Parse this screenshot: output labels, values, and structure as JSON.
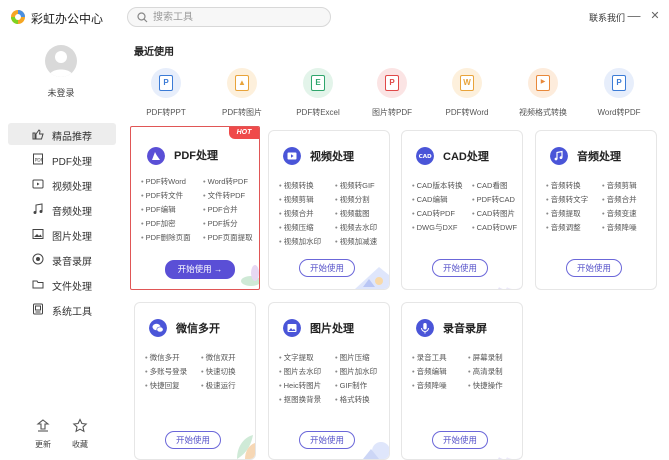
{
  "app": {
    "name": "彩虹办公中心"
  },
  "search": {
    "placeholder": "搜索工具"
  },
  "header": {
    "contact": "联系我们",
    "minimize_glyph": "—",
    "close_glyph": "✕"
  },
  "user": {
    "status": "未登录"
  },
  "sidebar": {
    "items": [
      {
        "label": "精品推荐",
        "icon": "thumbs-up-icon",
        "active": true
      },
      {
        "label": "PDF处理",
        "icon": "pdf-icon"
      },
      {
        "label": "视频处理",
        "icon": "video-icon"
      },
      {
        "label": "音频处理",
        "icon": "music-icon"
      },
      {
        "label": "图片处理",
        "icon": "image-icon"
      },
      {
        "label": "录音录屏",
        "icon": "record-icon"
      },
      {
        "label": "文件处理",
        "icon": "folder-icon"
      },
      {
        "label": "系统工具",
        "icon": "system-icon"
      }
    ],
    "bottom": [
      {
        "label": "更新",
        "icon": "update-icon"
      },
      {
        "label": "收藏",
        "icon": "star-icon"
      }
    ]
  },
  "recent": {
    "title": "最近使用",
    "items": [
      {
        "label": "PDF转PPT",
        "icon": "pdf-to-ppt-icon",
        "letter": "P",
        "color": "#3b7bd6",
        "bg": "#e7eefb"
      },
      {
        "label": "PDF转图片",
        "icon": "pdf-to-image-icon",
        "letter": "▲",
        "color": "#e8a33a",
        "bg": "#fdf0dc"
      },
      {
        "label": "PDF转Excel",
        "icon": "pdf-to-excel-icon",
        "letter": "E",
        "color": "#2ea56b",
        "bg": "#e3f4ea"
      },
      {
        "label": "图片转PDF",
        "icon": "image-to-pdf-icon",
        "letter": "P",
        "color": "#e04848",
        "bg": "#fbe4e4"
      },
      {
        "label": "PDF转Word",
        "icon": "pdf-to-word-icon",
        "letter": "W",
        "color": "#e8a33a",
        "bg": "#fdf0dc"
      },
      {
        "label": "视频格式转换",
        "icon": "video-convert-icon",
        "letter": "▶",
        "color": "#e8883a",
        "bg": "#fdecdc"
      },
      {
        "label": "Word转PDF",
        "icon": "word-to-pdf-icon",
        "letter": "P",
        "color": "#3b7bd6",
        "bg": "#e7eefb"
      }
    ]
  },
  "cards": [
    {
      "title": "PDF处理",
      "icon": "pdf-icon",
      "color": "#5a4fd6",
      "hot": "HOT",
      "start": "开始使用 →",
      "filled": true,
      "features": [
        "PDF转Word",
        "Word转PDF",
        "PDF转文件",
        "文件转PDF",
        "PDF编辑",
        "PDF合并",
        "PDF加密",
        "PDF拆分",
        "PDF删除页面",
        "PDF页面提取"
      ]
    },
    {
      "title": "视频处理",
      "icon": "video-icon",
      "color": "#4a55d8",
      "start": "开始使用",
      "features": [
        "视频转换",
        "视频转GIF",
        "视频剪辑",
        "视频分割",
        "视频合并",
        "视频截图",
        "视频压缩",
        "视频去水印",
        "视频加水印",
        "视频加减速"
      ]
    },
    {
      "title": "CAD处理",
      "icon": "cad-icon",
      "color": "#4a55d8",
      "start": "开始使用",
      "features": [
        "CAD版本转换",
        "CAD看图",
        "CAD编辑",
        "PDF转CAD",
        "CAD转PDF",
        "CAD转图片",
        "DWG与DXF",
        "CAD转DWF"
      ]
    },
    {
      "title": "音频处理",
      "icon": "music-icon",
      "color": "#4a55d8",
      "start": "开始使用",
      "features": [
        "音频转换",
        "音频剪辑",
        "音频转文字",
        "音频合并",
        "音频提取",
        "音频变速",
        "音频调整",
        "音频降噪"
      ]
    },
    {
      "title": "微信多开",
      "icon": "wechat-icon",
      "color": "#4a55d8",
      "start": "开始使用",
      "features": [
        "微信多开",
        "微信双开",
        "多账号登录",
        "快速切换",
        "快捷回复",
        "极速运行"
      ]
    },
    {
      "title": "图片处理",
      "icon": "image-icon",
      "color": "#4a55d8",
      "start": "开始使用",
      "features": [
        "文字提取",
        "图片压缩",
        "图片去水印",
        "图片加水印",
        "Heic转图片",
        "GIF制作",
        "抠图换背景",
        "格式转换"
      ]
    },
    {
      "title": "录音录屏",
      "icon": "mic-icon",
      "color": "#4a55d8",
      "start": "开始使用",
      "features": [
        "录音工具",
        "屏幕录制",
        "音频编辑",
        "高清录制",
        "音频降噪",
        "快捷操作"
      ]
    }
  ],
  "colors": {
    "accent": "#5a4fd6",
    "hot": "#ef4a4a",
    "highlight_border": "#e05656"
  }
}
